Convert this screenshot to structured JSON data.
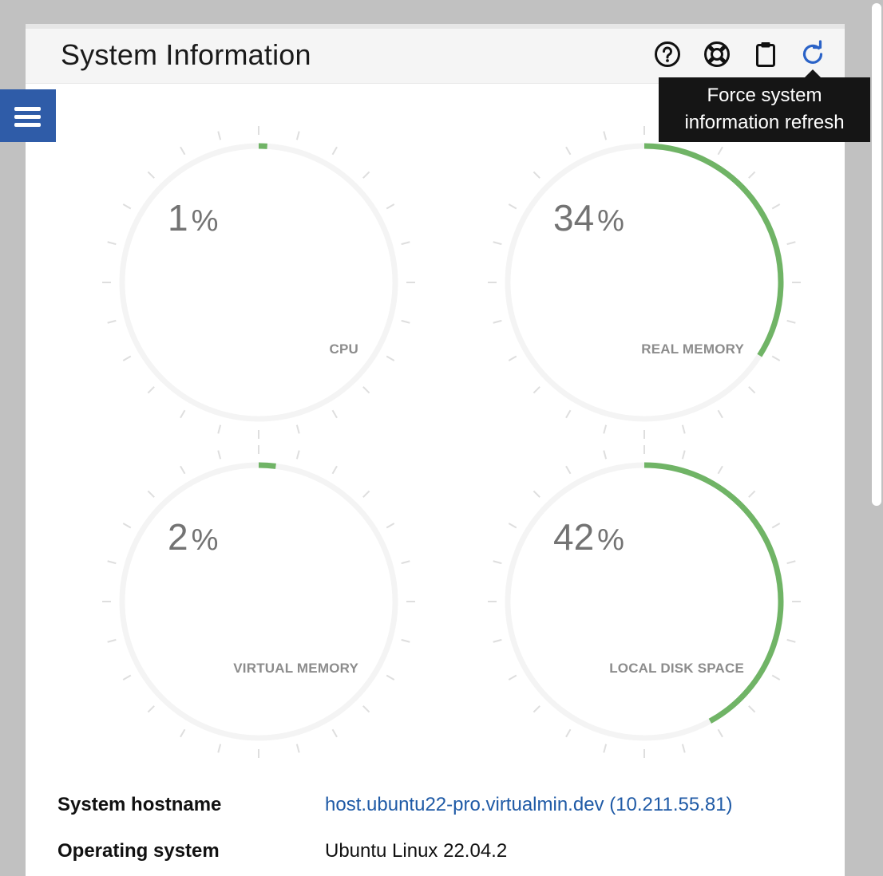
{
  "panel": {
    "title": "System Information",
    "icons": [
      "help-icon",
      "support-lifebuoy-icon",
      "clipboard-icon",
      "refresh-icon"
    ]
  },
  "tooltip": {
    "line1": "Force system",
    "line2": "information refresh"
  },
  "colors": {
    "accent": "#2f5ca8",
    "gauge_fill": "#70b466",
    "gauge_track": "#f4f4f4",
    "link": "#1f5aa6"
  },
  "gauges": [
    {
      "value": "1",
      "unit": "%",
      "label": "CPU",
      "percent": 1
    },
    {
      "value": "34",
      "unit": "%",
      "label": "REAL MEMORY",
      "percent": 34
    },
    {
      "value": "2",
      "unit": "%",
      "label": "VIRTUAL MEMORY",
      "percent": 2
    },
    {
      "value": "42",
      "unit": "%",
      "label": "LOCAL DISK SPACE",
      "percent": 42
    }
  ],
  "info": [
    {
      "key": "System hostname",
      "value": "host.ubuntu22-pro.virtualmin.dev (10.211.55.81)",
      "is_link": true
    },
    {
      "key": "Operating system",
      "value": "Ubuntu Linux 22.04.2",
      "is_link": false
    }
  ]
}
